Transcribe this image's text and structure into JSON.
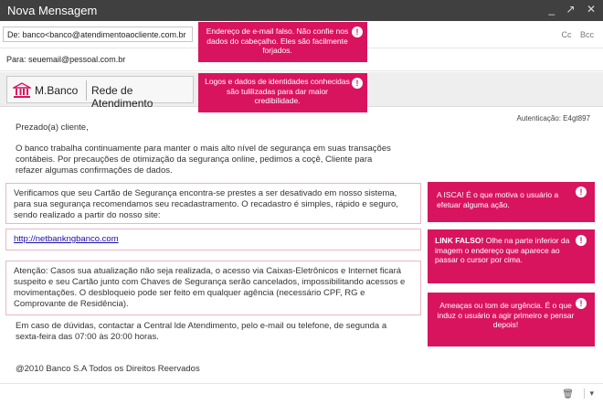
{
  "window": {
    "title": "Nova Mensagem",
    "controls": [
      "_",
      "↗",
      "✕"
    ]
  },
  "header": {
    "from": "De: banco<banco@atendimentoaocliente.com.br",
    "cc_label": "Cc",
    "bcc_label": "Bcc",
    "to": "Para: seuemail@pessoal.com.br"
  },
  "banner": {
    "bank_name": "M.Banco",
    "network_name": "Rede de Atendimento",
    "icon": "bank-building-icon"
  },
  "email": {
    "auth": "Autenticação: E4gt897",
    "greeting": "Prezado(a) cliente,",
    "paragraph_1": "O banco trabalha continuamente para manter o mais alto nível de segurança em suas transações contábeis. Por precauções de otimização da segurança online, pedimos a coçê, Cliente para refazer algumas confirmações de dados.",
    "paragraph_2": "Verificamos que seu Cartão de Segurança encontra-se prestes a ser desativado em nosso sistema, para sua segurança recomendamos seu recadastramento. O recadastro é simples, rápido e seguro, sendo realizado a partir do nosso site:",
    "link": "http://netbankngbanco.com",
    "paragraph_3": "Atenção: Casos sua atualização não seja realizada, o acesso via Caixas-Eletrônicos e Internet ficará suspeito e seu Cartão junto com Chaves de Segurança serão cancelados, impossibilitando acessos e movimentações. O desbloqueio pode ser feito em qualquer agência (necessário CPF, RG e Comprovante de Residência).",
    "paragraph_4": "Em caso de dúvidas, contactar a Central lde Atendimento, pelo e-mail ou telefone, de segunda a sexta-feira das 07:00 às 20:00 horas.",
    "footer": "@2010 Banco S.A Todos os Direitos Reervados"
  },
  "callouts": {
    "alert_symbol": "!",
    "fake_sender": "Endereço de e-mail falso. Não confie nos dados do cabeçalho. Eles são facilmente forjados.",
    "fake_logos": "Logos e dados de identidades conhecidas são tulilizadas para dar maior credibilidade.",
    "bait": "A ISCA! É o que motiva o usuário a efetuar alguma ação.",
    "fake_link_title": "LINK FALSO!",
    "fake_link_text": " Olhe na parte inferior da imagem o endereço que aparece ao passar o cursor por cima.",
    "threats": "Ameaças ou tom de urgência. É o que induz o usuário a agir primeiro e pensar depois!"
  },
  "toolbar": {
    "trash_icon": "trash-icon",
    "more_icon": "chevron-down-icon"
  },
  "colors": {
    "titlebar": "#404040",
    "callout": "#d9145f",
    "callout_border": "#e8b7c7",
    "link": "#1a0dab"
  }
}
